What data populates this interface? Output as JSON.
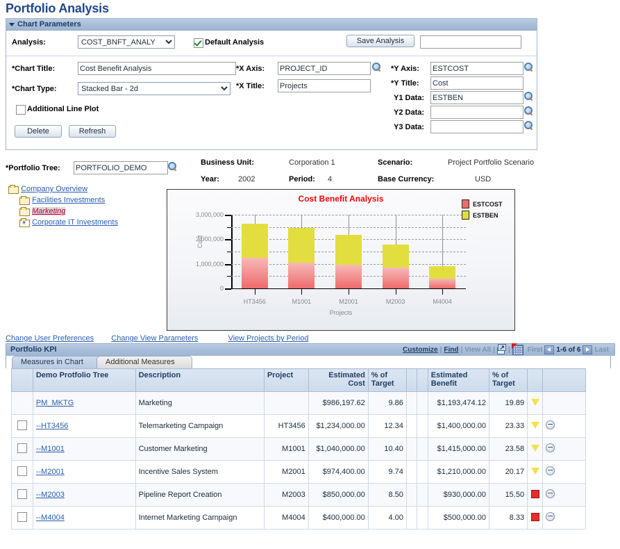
{
  "page": {
    "title": "Portfolio Analysis"
  },
  "chart_params": {
    "section_title": "Chart Parameters",
    "analysis_label": "Analysis:",
    "analysis_value": "COST_BNFT_ANALY",
    "default_analysis_label": "Default Analysis",
    "default_analysis_checked": true,
    "save_analysis_label": "Save Analysis",
    "save_analysis_value": "",
    "chart_title_label": "*Chart Title:",
    "chart_title_value": "Cost Benefit Analysis",
    "chart_type_label": "*Chart Type:",
    "chart_type_value": "Stacked Bar - 2d",
    "additional_line_plot_label": "Additional Line Plot",
    "additional_line_plot_checked": false,
    "delete_label": "Delete",
    "refresh_label": "Refresh",
    "x_axis_label": "*X Axis:",
    "x_axis_value": "PROJECT_ID",
    "x_title_label": "*X Title:",
    "x_title_value": "Projects",
    "y_axis_label": "*Y Axis:",
    "y_axis_value": "ESTCOST",
    "y_title_label": "*Y Title:",
    "y_title_value": "Cost",
    "y1_data_label": "Y1 Data:",
    "y1_data_value": "ESTBEN",
    "y2_data_label": "Y2 Data:",
    "y2_data_value": "",
    "y3_data_label": "Y3 Data:",
    "y3_data_value": ""
  },
  "portfolio": {
    "tree_label": "*Portfolio Tree:",
    "tree_value": "PORTFOLIO_DEMO",
    "business_unit_label": "Business Unit:",
    "business_unit_value": "Corporation 1",
    "scenario_label": "Scenario:",
    "scenario_value": "Project Portfolio Scenario",
    "year_label": "Year:",
    "year_value": "2002",
    "period_label": "Period:",
    "period_value": "4",
    "base_currency_label": "Base Currency:",
    "base_currency_value": "USD",
    "tree_nodes": [
      {
        "label": "Company Overview",
        "level": 0,
        "icon": "folder-open-icon",
        "current": false
      },
      {
        "label": "Facilities Investments",
        "level": 1,
        "icon": "folder-open-icon",
        "current": false
      },
      {
        "label": "Marketing",
        "level": 1,
        "icon": "folder-open-icon",
        "current": true
      },
      {
        "label": "Corporate IT Investments",
        "level": 1,
        "icon": "folder-plus-icon",
        "current": false
      }
    ]
  },
  "chart_data": {
    "type": "bar",
    "stacked": true,
    "title": "Cost Benefit Analysis",
    "xlabel": "Projects",
    "ylabel": "Cost",
    "categories": [
      "HT3456",
      "M1001",
      "M2001",
      "M2003",
      "M4004"
    ],
    "series": [
      {
        "name": "ESTCOST",
        "color": "#EE6B6B",
        "values": [
          1234000,
          1040000,
          974400,
          850000,
          400000
        ]
      },
      {
        "name": "ESTBEN",
        "color": "#E2DE3F",
        "values": [
          1400000,
          1415000,
          1210000,
          930000,
          500000
        ]
      }
    ],
    "ylim": [
      0,
      3000000
    ],
    "ytick_labels": [
      "0",
      "1,000,000",
      "2,000,000",
      "3,000,000"
    ],
    "ytick_values": [
      0,
      1000000,
      2000000,
      3000000
    ],
    "minor_gridlines": [
      500000,
      1500000,
      2500000
    ],
    "grid": true,
    "legend_position": "right"
  },
  "links": {
    "change_user_preferences": "Change User Preferences",
    "change_view_parameters": "Change View Parameters",
    "view_projects_by_period": "View Projects by Period"
  },
  "kpi": {
    "header_title": "Portfolio KPI",
    "toolbar": {
      "customize": "Customize",
      "find": "Find",
      "view_all": "View All",
      "first": "First",
      "range": "1-6 of 6",
      "last": "Last",
      "sep": "|"
    },
    "tabs": [
      {
        "label": "Measures in Chart",
        "active": true
      },
      {
        "label": "Additional Measures",
        "active": false
      }
    ],
    "columns": [
      "",
      "Demo Protfolio Tree",
      "Description",
      "Project",
      "Estimated Cost",
      "% of Target",
      "",
      "",
      "Estimated Benefit",
      "% of Target",
      "",
      ""
    ],
    "rows": [
      {
        "checkbox": false,
        "tree": "PM_MKTG",
        "description": "Marketing",
        "project": "",
        "est_cost": "$986,197.62",
        "cost_pct": "9.86",
        "est_benefit": "$1,193,474.12",
        "benefit_pct": "19.89",
        "status": "triangle-yellow",
        "remove": false
      },
      {
        "checkbox": true,
        "tree": "--HT3456",
        "description": "Telemarketing Campaign",
        "project": "HT3456",
        "est_cost": "$1,234,000.00",
        "cost_pct": "12.34",
        "est_benefit": "$1,400,000.00",
        "benefit_pct": "23.33",
        "status": "triangle-yellow",
        "remove": true
      },
      {
        "checkbox": true,
        "tree": "--M1001",
        "description": "Customer Marketing",
        "project": "M1001",
        "est_cost": "$1,040,000.00",
        "cost_pct": "10.40",
        "est_benefit": "$1,415,000.00",
        "benefit_pct": "23.58",
        "status": "triangle-yellow",
        "remove": true
      },
      {
        "checkbox": true,
        "tree": "--M2001",
        "description": "Incentive Sales System",
        "project": "M2001",
        "est_cost": "$974,400.00",
        "cost_pct": "9.74",
        "est_benefit": "$1,210,000.00",
        "benefit_pct": "20.17",
        "status": "triangle-yellow",
        "remove": true
      },
      {
        "checkbox": true,
        "tree": "--M2003",
        "description": "Pipeline Report Creation",
        "project": "M2003",
        "est_cost": "$850,000.00",
        "cost_pct": "8.50",
        "est_benefit": "$930,000.00",
        "benefit_pct": "15.50",
        "status": "square-red",
        "remove": true
      },
      {
        "checkbox": true,
        "tree": "--M4004",
        "description": "Internet Marketing Campaign",
        "project": "M4004",
        "est_cost": "$400,000.00",
        "cost_pct": "4.00",
        "est_benefit": "$500,000.00",
        "benefit_pct": "8.33",
        "status": "square-red",
        "remove": true
      }
    ]
  }
}
